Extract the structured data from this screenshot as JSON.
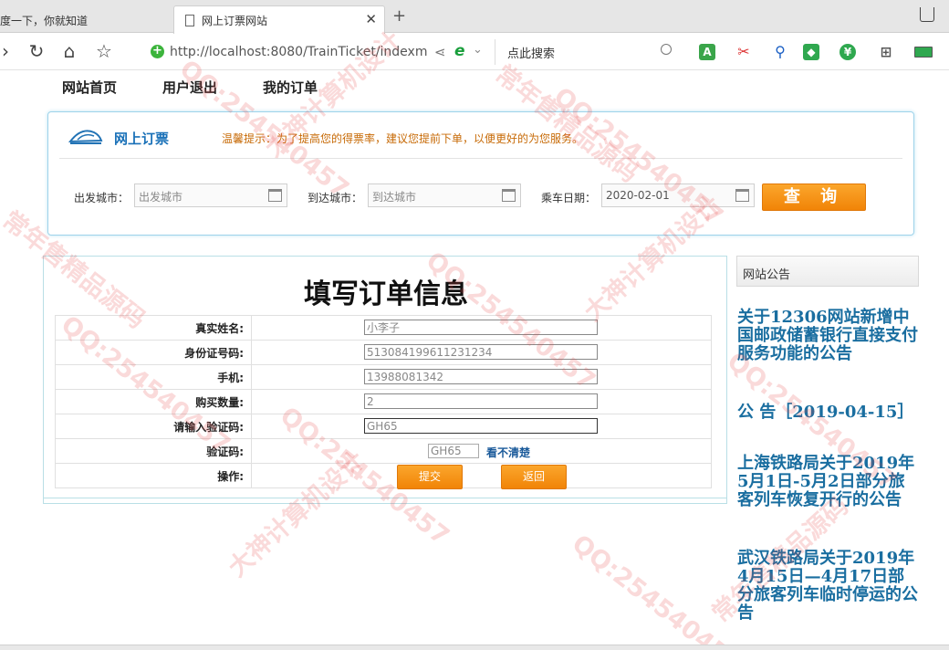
{
  "browser": {
    "inactive_tab": "度一下，你就知道",
    "active_tab": "网上订票网站",
    "url": "http://localhost:8080/TrainTicket/indexm",
    "search_placeholder": "点此搜索"
  },
  "nav": {
    "home": "网站首页",
    "logout": "用户退出",
    "orders": "我的订单"
  },
  "search_panel": {
    "title": "网上订票",
    "tip": "温馨提示：为了提高您的得票率，建议您提前下单，以便更好的为您服务。",
    "from_label": "出发城市：",
    "from_placeholder": "出发城市",
    "to_label": "到达城市：",
    "to_placeholder": "到达城市",
    "date_label": "乘车日期：",
    "date_value": "2020-02-01",
    "query_button": "查 询"
  },
  "order_form": {
    "title": "填写订单信息",
    "rows": [
      {
        "label": "真实姓名:",
        "value": "小李子"
      },
      {
        "label": "身份证号码:",
        "value": "513084199611231234"
      },
      {
        "label": "手机:",
        "value": "13988081342"
      },
      {
        "label": "购买数量:",
        "value": "2"
      },
      {
        "label": "请输入验证码:",
        "value": "GH65"
      }
    ],
    "captcha_label": "验证码:",
    "captcha_code": "GH65",
    "captcha_refresh": "看不清楚",
    "action_label": "操作:",
    "submit_button": "提交",
    "back_button": "返回"
  },
  "notices": {
    "header": "网站公告",
    "items": [
      "关于12306网站新增中国邮政储蓄银行直接支付服务功能的公告",
      "公 告［2019-04-15］",
      "上海铁路局关于2019年5月1日-5月2日部分旅客列车恢复开行的公告",
      "武汉铁路局关于2019年4月15日—4月17日部分旅客列车临时停运的公告"
    ]
  },
  "watermark": {
    "qq": "QQ:254540457",
    "text_a": "大神计算机设计",
    "text_b": "常年售精品源码"
  }
}
